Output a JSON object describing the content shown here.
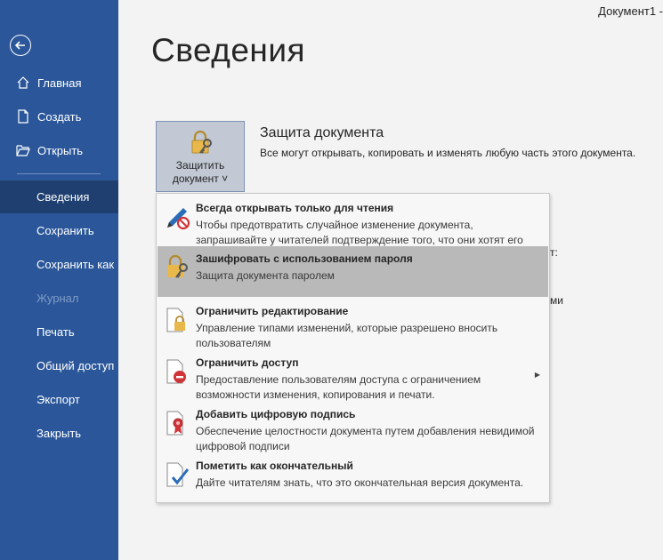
{
  "window": {
    "doc_title": "Документ1  -"
  },
  "sidebar": {
    "items": [
      {
        "id": "home",
        "label": "Главная"
      },
      {
        "id": "new",
        "label": "Создать"
      },
      {
        "id": "open",
        "label": "Открыть"
      },
      {
        "id": "info",
        "label": "Сведения",
        "active": true
      },
      {
        "id": "save",
        "label": "Сохранить"
      },
      {
        "id": "saveas",
        "label": "Сохранить как"
      },
      {
        "id": "history",
        "label": "Журнал",
        "disabled": true
      },
      {
        "id": "print",
        "label": "Печать"
      },
      {
        "id": "share",
        "label": "Общий доступ"
      },
      {
        "id": "export",
        "label": "Экспорт"
      },
      {
        "id": "close",
        "label": "Закрыть"
      }
    ]
  },
  "main": {
    "page_title": "Сведения",
    "protect": {
      "button_line1": "Защитить",
      "button_line2": "документ ˅",
      "title": "Защита документа",
      "desc": "Все могут открывать, копировать и изменять любую часть этого документа."
    },
    "peek_text_1": "т:",
    "peek_text_2": "ми"
  },
  "menu": {
    "items": [
      {
        "id": "readonly",
        "title": "Всегда открывать только для чтения",
        "desc": "Чтобы предотвратить случайное изменение документа, запрашивайте у читателей подтверждение того, что они хотят его править.",
        "icon": "pencil-forbid-icon"
      },
      {
        "id": "encrypt",
        "title": "Зашифровать с использованием пароля",
        "desc": "Защита документа паролем",
        "icon": "lock-key-icon",
        "highlighted": true
      },
      {
        "id": "restrict_edit",
        "title": "Ограничить редактирование",
        "desc": "Управление типами изменений, которые разрешено вносить пользователям",
        "icon": "document-lock-icon"
      },
      {
        "id": "restrict_access",
        "title": "Ограничить доступ",
        "desc": "Предоставление пользователям доступа с ограничением возможности изменения, копирования и печати.",
        "icon": "document-restrict-icon",
        "has_submenu": true
      },
      {
        "id": "signature",
        "title": "Добавить цифровую подпись",
        "desc": "Обеспечение целостности документа путем добавления невидимой цифровой подписи",
        "icon": "document-ribbon-icon"
      },
      {
        "id": "final",
        "title": "Пометить как окончательный",
        "desc": "Дайте читателям знать, что это окончательная версия документа.",
        "icon": "document-check-icon"
      }
    ]
  },
  "colors": {
    "sidebar": "#2b579a",
    "sidebar_active": "#1e3f6f",
    "highlight": "#b9b9b9",
    "accent_gold": "#e8b84a"
  }
}
